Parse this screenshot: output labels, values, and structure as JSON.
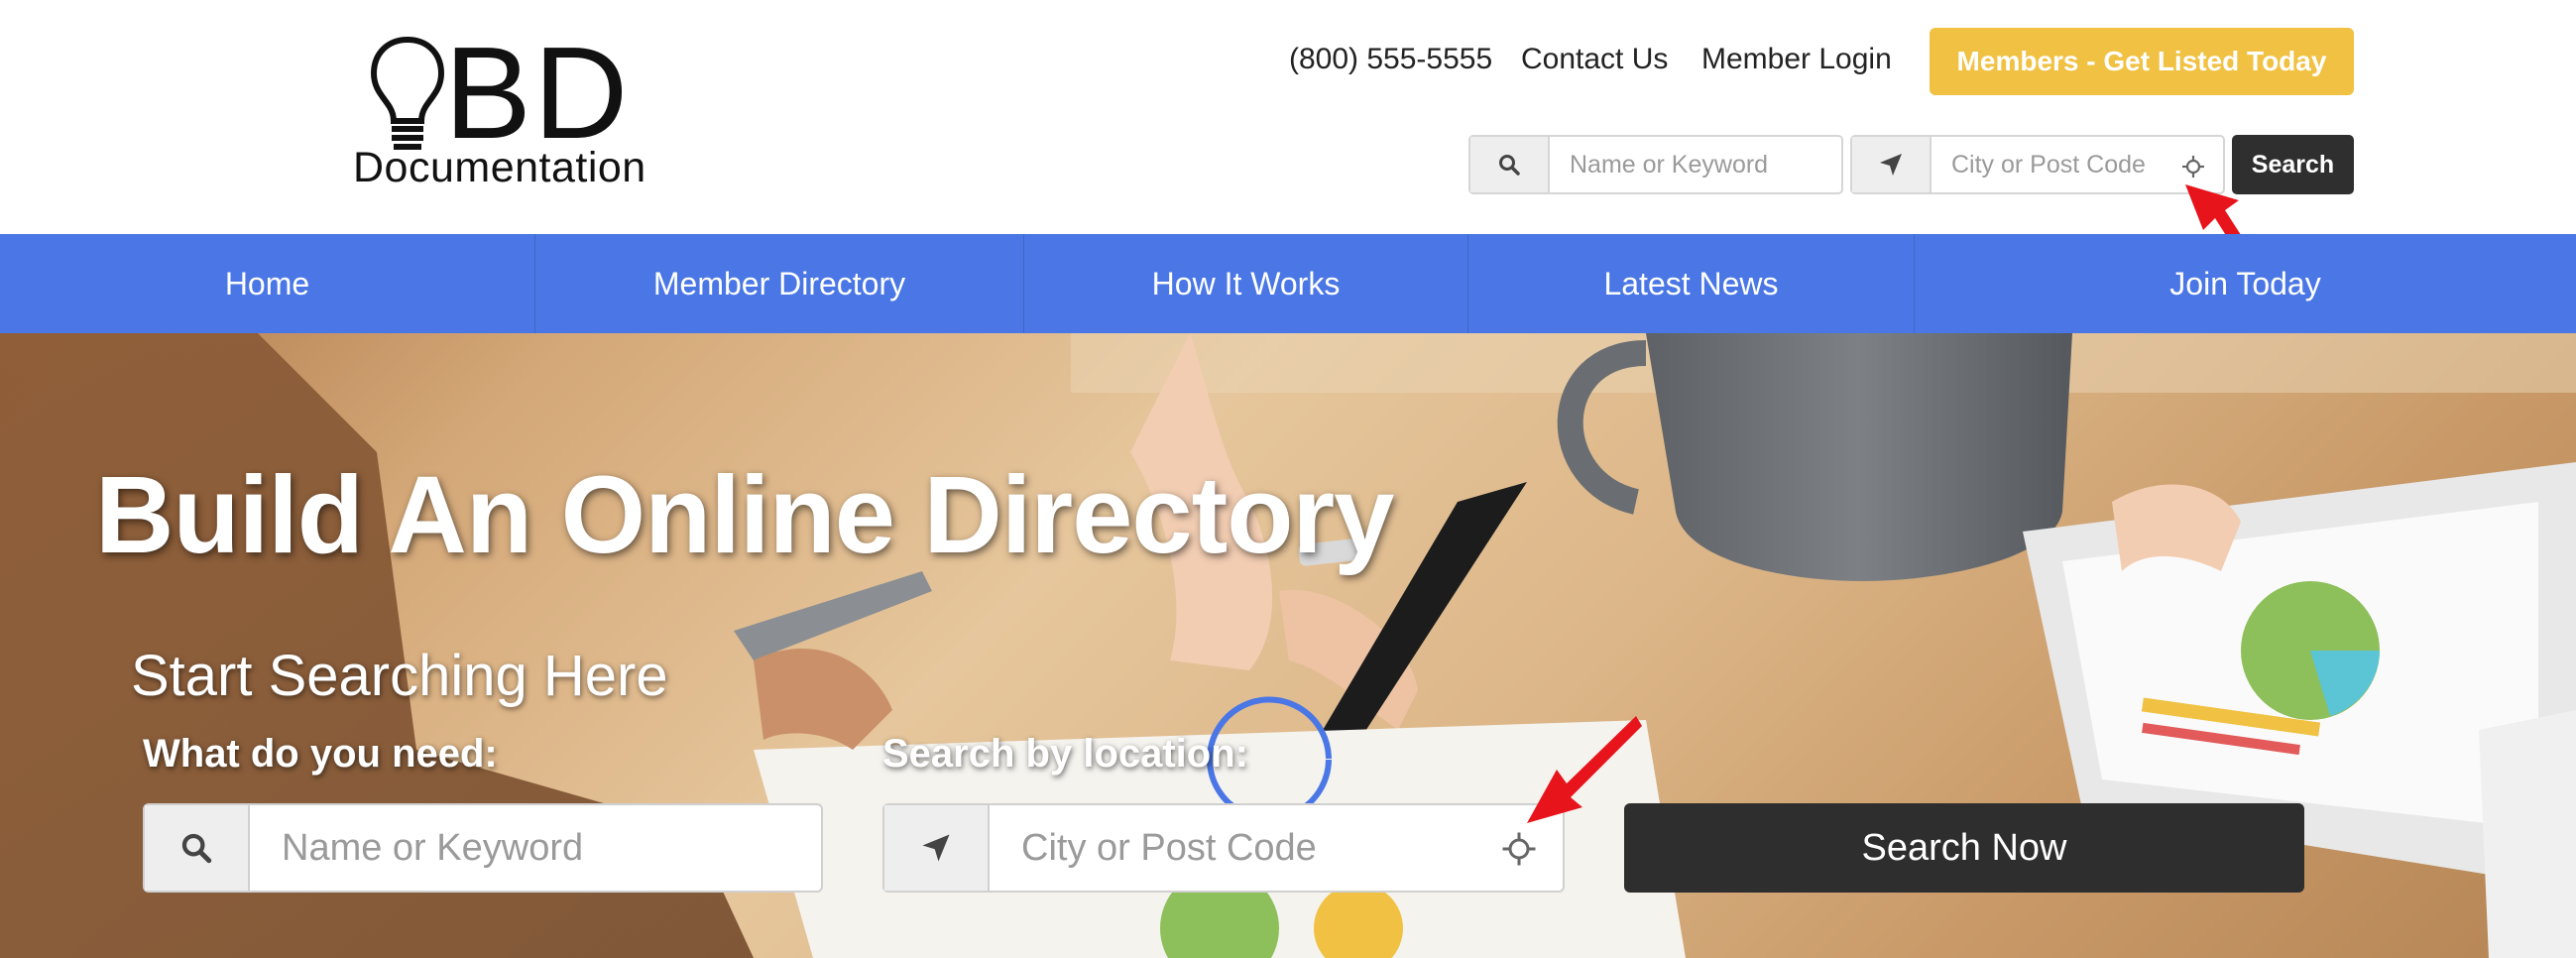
{
  "header": {
    "logo": {
      "mark": "BD",
      "subtitle": "Documentation"
    },
    "phone": "(800) 555-5555",
    "contact_label": "Contact Us",
    "login_label": "Member Login",
    "cta_label": "Members - Get Listed Today",
    "cta_color": "#f0c142",
    "search": {
      "keyword_placeholder": "Name or Keyword",
      "location_placeholder": "City or Post Code",
      "button_label": "Search"
    }
  },
  "nav": {
    "color": "#4a77e5",
    "items": [
      {
        "label": "Home"
      },
      {
        "label": "Member Directory"
      },
      {
        "label": "How It Works"
      },
      {
        "label": "Latest News"
      },
      {
        "label": "Join Today"
      }
    ]
  },
  "hero": {
    "title": "Build An Online Directory",
    "subtitle": "Start Searching Here",
    "keyword_label": "What do you need:",
    "location_label": "Search by location:",
    "keyword_placeholder": "Name or Keyword",
    "location_placeholder": "City or Post Code",
    "button_label": "Search Now"
  },
  "annotations": {
    "arrow_color": "#e8141b"
  }
}
